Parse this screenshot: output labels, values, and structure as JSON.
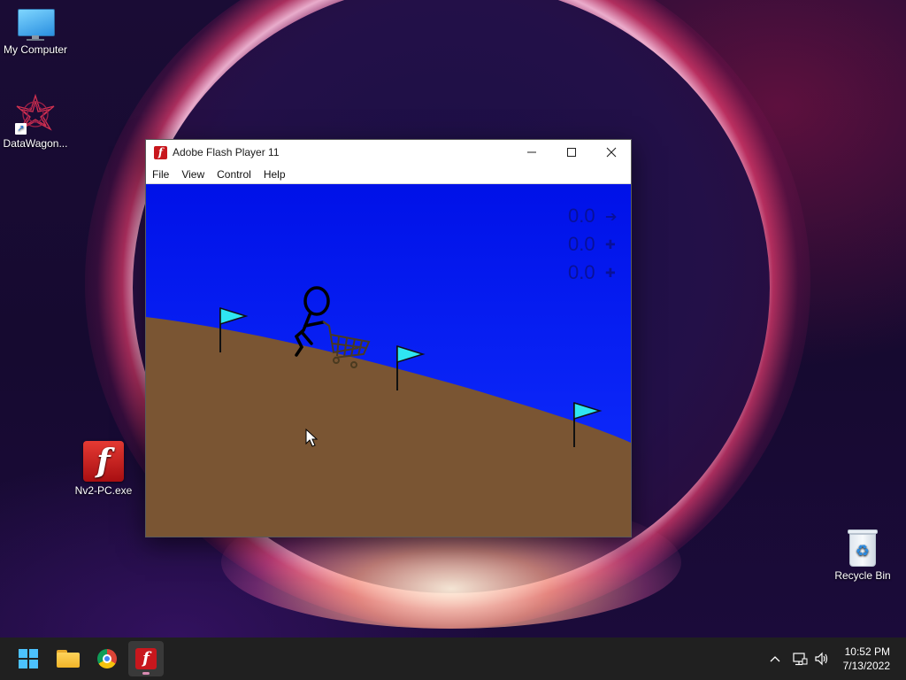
{
  "desktop": {
    "icons": [
      {
        "label": "My Computer",
        "icon": "computer-icon"
      },
      {
        "label": "DataWagon...",
        "icon": "datawagon-shortcut-icon"
      },
      {
        "label": "Nv2-PC.exe",
        "icon": "flash-exe-icon"
      },
      {
        "label": "Recycle Bin",
        "icon": "recycle-bin-icon"
      }
    ]
  },
  "window": {
    "title": "Adobe Flash Player 11",
    "menu": [
      "File",
      "View",
      "Control",
      "Help"
    ],
    "buttons": {
      "minimize": "—",
      "maximize": "☐",
      "close": "✕"
    }
  },
  "game": {
    "hud": [
      {
        "value": "0.0",
        "symbol": "➔"
      },
      {
        "value": "0.0",
        "symbol": "✚"
      },
      {
        "value": "0.0",
        "symbol": "✚"
      }
    ],
    "colors": {
      "sky": "#0b14f0",
      "ground": "#7a5533",
      "flag": "#2fe6f2"
    }
  },
  "taskbar": {
    "apps": [
      "start-icon",
      "file-explorer-icon",
      "chrome-icon",
      "flash-player-icon"
    ],
    "tray_chevron": "^",
    "time": "10:52 PM",
    "date": "7/13/2022"
  }
}
